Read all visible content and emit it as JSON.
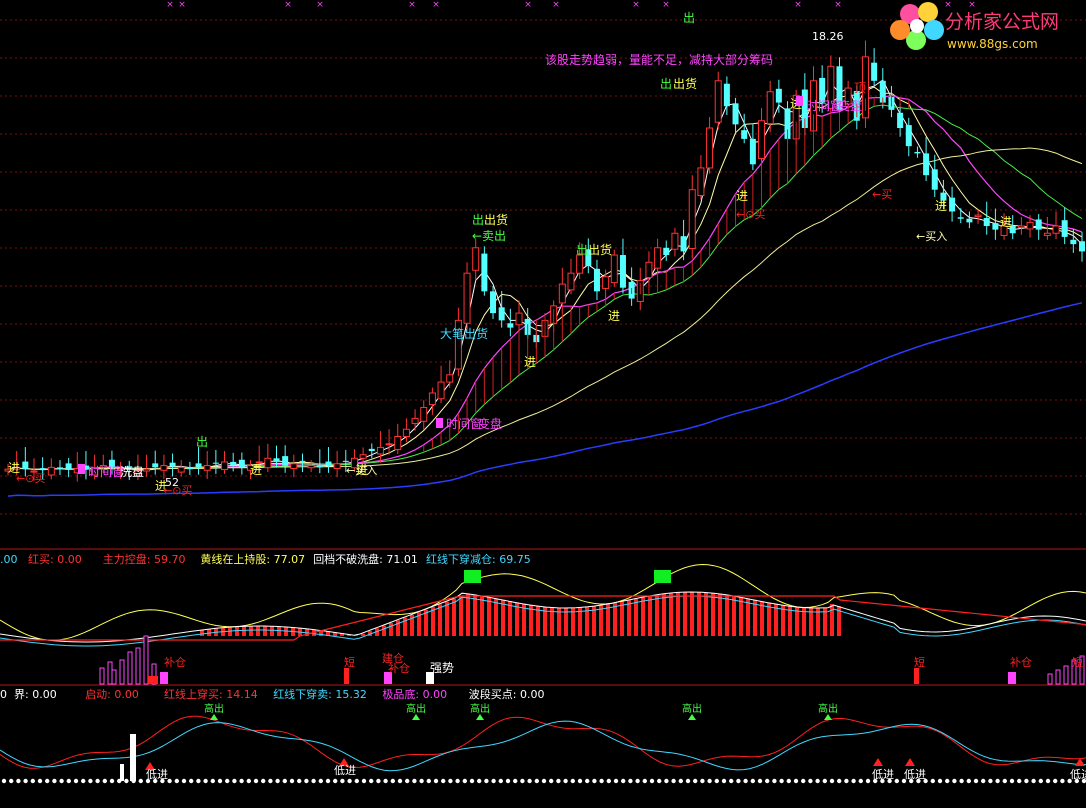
{
  "logo": {
    "title": "分析家公式网",
    "url": "www.88gs.com"
  },
  "colors": {
    "bg": "#000000",
    "up": "#ff3333",
    "down": "#54ffff",
    "white": "#ffffff",
    "yellow": "#ffff55",
    "magenta": "#ff44ff",
    "green": "#44ff44",
    "blue": "#2233ff",
    "red": "#ff2020",
    "cyan": "#40d8ff"
  },
  "chart_data": [
    {
      "type": "candlestick",
      "panel": "main",
      "price_labels": [
        "18.26",
        "52"
      ],
      "annotations": {
        "top_note": "该股走势趋弱，量能不足，减持大部分筹码",
        "chu": "出",
        "chu_huo": "出货",
        "mai_chu": "卖出",
        "da_bi_chu_huo": "大笔出货",
        "jin": "进",
        "mai_ru": "买入",
        "mai": "买",
        "ding": "顶",
        "shi_jian_chuang": "时间窗",
        "bian_pan": "变盘",
        "xi_pan": "洗盘",
        "mai_arrow": "←⊙买",
        "mai_ru_arrow": "←买入",
        "arrow_buy": "←⊙买"
      },
      "close": [
        6.9,
        6.95,
        6.9,
        6.85,
        6.9,
        6.95,
        6.9,
        6.88,
        6.92,
        6.9,
        6.95,
        7.0,
        6.95,
        6.9,
        6.88,
        6.85,
        6.9,
        6.95,
        7.0,
        6.98,
        6.95,
        6.9,
        6.95,
        7.0,
        7.05,
        7.1,
        7.0,
        6.95,
        7.0,
        7.1,
        7.2,
        7.1,
        7.0,
        7.05,
        7.1,
        7.0,
        6.95,
        7.0,
        7.05,
        7.1,
        7.2,
        7.3,
        7.4,
        7.5,
        7.6,
        7.8,
        8.0,
        8.3,
        8.6,
        9.0,
        9.3,
        9.5,
        11.0,
        12.3,
        13.0,
        11.8,
        11.2,
        11.0,
        10.8,
        11.2,
        10.6,
        10.4,
        11.0,
        11.4,
        12.0,
        12.3,
        12.8,
        12.5,
        11.8,
        12.2,
        12.8,
        11.9,
        11.6,
        12.1,
        12.6,
        13.0,
        12.8,
        13.4,
        12.9,
        14.6,
        15.2,
        16.3,
        17.6,
        16.9,
        16.4,
        16.0,
        15.3,
        16.5,
        17.3,
        17.0,
        16.0,
        17.2,
        16.3,
        17.6,
        17.0,
        18.0,
        16.8,
        17.4,
        16.5,
        18.26,
        17.6,
        17.0,
        16.8,
        16.3,
        15.8,
        15.6,
        15.0,
        14.6,
        14.3,
        14.0,
        13.8,
        13.7,
        13.9,
        13.6,
        13.5,
        13.6,
        13.4,
        13.6,
        13.7,
        13.5,
        13.4,
        13.6,
        13.3,
        13.1,
        12.9
      ],
      "legend_main_panel": ""
    },
    {
      "type": "indicator",
      "panel": "middle",
      "legend": [
        {
          "name": "红买",
          "value": "0.00",
          "color": "#ff3333"
        },
        {
          "name": "主力控盘",
          "value": "59.70",
          "color": "#ff3333"
        },
        {
          "name": "黄线在上持股",
          "value": "77.07",
          "color": "#ffff55"
        },
        {
          "name": "回档不破洗盘",
          "value": "71.01",
          "color": "#ffffff"
        },
        {
          "name": "红线下穿减仓",
          "value": "69.75",
          "color": "#40d8ff"
        }
      ],
      "legend_prefix": ".00",
      "labels": {
        "zheng": "短",
        "bu_cang": "补仓",
        "lai_cang": "建仓",
        "qiang_shi": "强势"
      }
    },
    {
      "type": "indicator",
      "panel": "bottom",
      "legend": [
        {
          "name": "界",
          "value": "0.00",
          "color": "#ffffff"
        },
        {
          "name": "启动",
          "value": "0.00",
          "color": "#ff3333"
        },
        {
          "name": "红线上穿买",
          "value": "14.14",
          "color": "#ff3333"
        },
        {
          "name": "红线下穿卖",
          "value": "15.32",
          "color": "#40d8ff"
        },
        {
          "name": "极品底",
          "value": "0.00",
          "color": "#ff44ff"
        },
        {
          "name": "波段买点",
          "value": "0.00",
          "color": "#ffffff"
        }
      ],
      "legend_prefix": "0",
      "labels": {
        "di_jin": "低进",
        "gao_chu": "高出"
      }
    }
  ]
}
